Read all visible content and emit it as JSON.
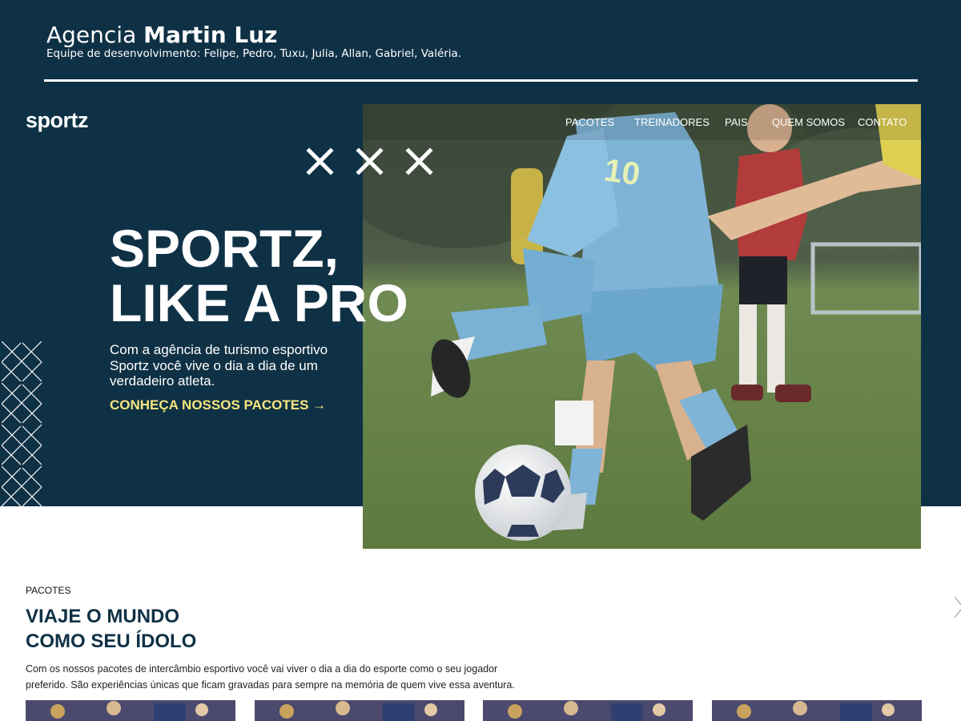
{
  "banner": {
    "title_prefix": "Agencia",
    "title_name": "Martin Luz",
    "team": "Equipe de desenvolvimento: Felipe, Pedro, Tuxu, Julia, Allan, Gabriel, Valéria."
  },
  "header": {
    "logo": "sportz",
    "nav": [
      "PACOTES",
      "TREINADORES",
      "PAIS",
      "QUEM SOMOS",
      "CONTATO"
    ]
  },
  "hero": {
    "title_line1": "SPORTZ,",
    "title_line2": "LIKE A PRO",
    "text": "Com a agência de turismo esportivo Sportz você vive o dia a dia de um verdadeiro atleta.",
    "cta": "CONHEÇA NOSSOS PACOTES →"
  },
  "packages": {
    "kicker": "PACOTES",
    "title_line1": "VIAJE O MUNDO",
    "title_line2": "COMO SEU ÍDOLO",
    "text": "Com os nossos pacotes de intercâmbio esportivo você vai viver o dia a dia do esporte como o seu jogador preferido. São experiências únicas que ficam gravadas para sempre na memória de quem vive essa aventura."
  },
  "colors": {
    "navy": "#0f3145",
    "accent_yellow": "#f5e67e",
    "white": "#ffffff"
  },
  "icons": {
    "decor_xxx": "x-marks-icon",
    "decor_diamonds": "diamond-pattern-icon",
    "cta_arrow": "arrow-right-icon"
  }
}
